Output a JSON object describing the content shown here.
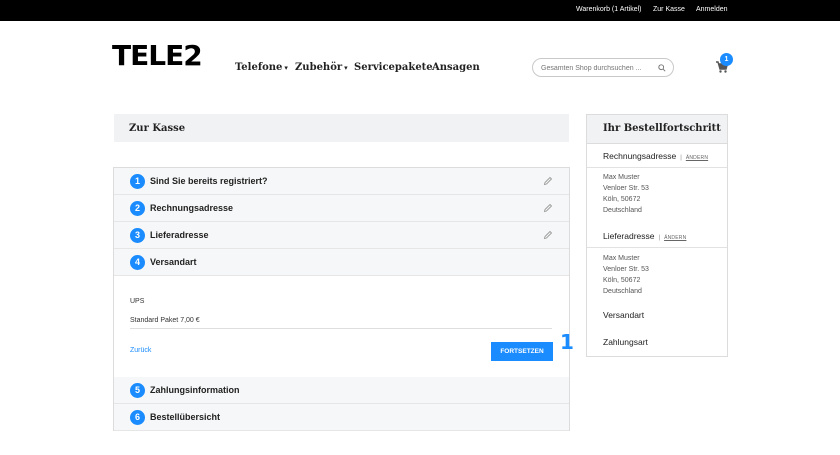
{
  "topbar": {
    "cart_link": "Warenkorb (1 Artikel)",
    "checkout_link": "Zur Kasse",
    "login_link": "Anmelden"
  },
  "logo": {
    "text": "TELE2"
  },
  "nav": {
    "items": [
      {
        "label": "Telefone",
        "caret": "▾"
      },
      {
        "label": "Zubehör",
        "caret": "▾"
      },
      {
        "label": "Servicepakete"
      },
      {
        "label": "Ansagen"
      }
    ]
  },
  "search": {
    "placeholder": "Gesamten Shop durchsuchen ...",
    "icon": "search-icon"
  },
  "cart": {
    "count": "1",
    "icon": "cart-icon"
  },
  "checkout": {
    "title": "Zur Kasse"
  },
  "steps": [
    {
      "number": "1",
      "title": "Sind Sie bereits registriert?"
    },
    {
      "number": "2",
      "title": "Rechnungsadresse"
    },
    {
      "number": "3",
      "title": "Lieferadresse"
    },
    {
      "number": "4",
      "title": "Versandart"
    },
    {
      "number": "5",
      "title": "Zahlungsinformation"
    },
    {
      "number": "6",
      "title": "Bestellübersicht"
    }
  ],
  "shipping": {
    "method": "UPS",
    "rate": "Standard Paket 7,00 €",
    "back_label": "Zurück",
    "continue_label": "FORTSETZEN",
    "badge_number": "1"
  },
  "progress": {
    "title": "Ihr Bestellfortschritt",
    "separator": "|",
    "change_label": "ÄNDERN",
    "billing": {
      "label": "Rechnungsadresse",
      "lines": [
        "Max Muster",
        "Venloer Str. 53",
        "Köln, 50672",
        "Deutschland"
      ]
    },
    "shipping_addr": {
      "label": "Lieferadresse",
      "lines": [
        "Max Muster",
        "Venloer Str. 53",
        "Köln, 50672",
        "Deutschland"
      ]
    },
    "shipping_method": {
      "label": "Versandart"
    },
    "payment": {
      "label": "Zahlungsart"
    }
  },
  "colors": {
    "accent": "#1a8cff",
    "topbar": "#000000",
    "panel": "#f1f2f4"
  }
}
